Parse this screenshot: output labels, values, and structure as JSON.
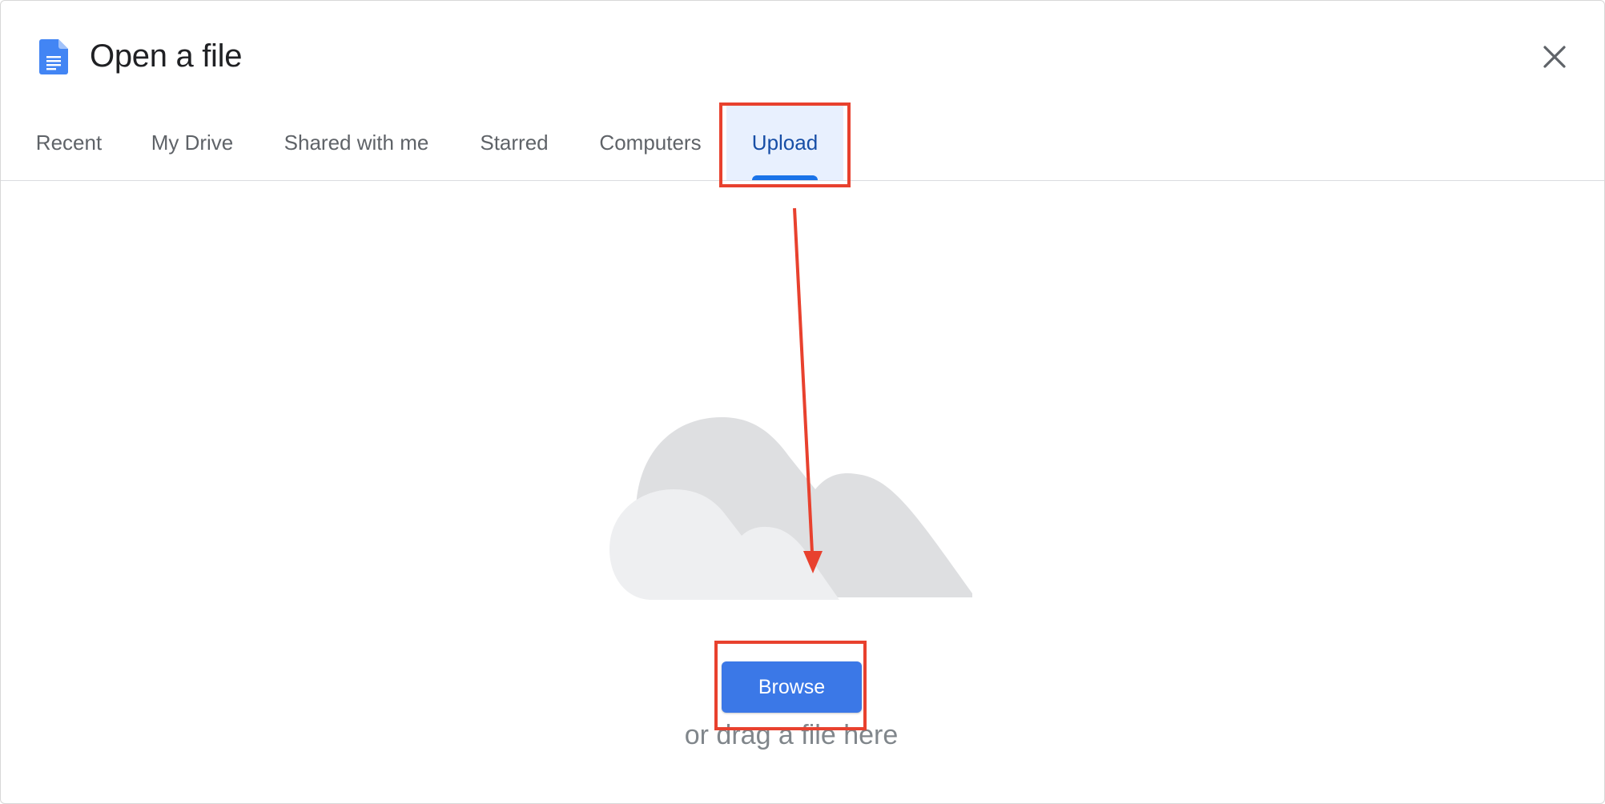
{
  "dialog": {
    "title": "Open a file",
    "app_icon": "google-docs-icon",
    "close_icon": "close-icon"
  },
  "tabs": [
    {
      "label": "Recent",
      "active": false
    },
    {
      "label": "My Drive",
      "active": false
    },
    {
      "label": "Shared with me",
      "active": false
    },
    {
      "label": "Starred",
      "active": false
    },
    {
      "label": "Computers",
      "active": false
    },
    {
      "label": "Upload",
      "active": true
    }
  ],
  "upload": {
    "illustration": "cloud-illustration",
    "browse_label": "Browse",
    "drag_text": "or drag a file here"
  },
  "colors": {
    "accent": "#1a73e8",
    "active_tab_text": "#174ea6",
    "active_tab_bg": "#e8f0fe",
    "browse_button": "#3b78e7",
    "annotation": "#e8412e"
  }
}
